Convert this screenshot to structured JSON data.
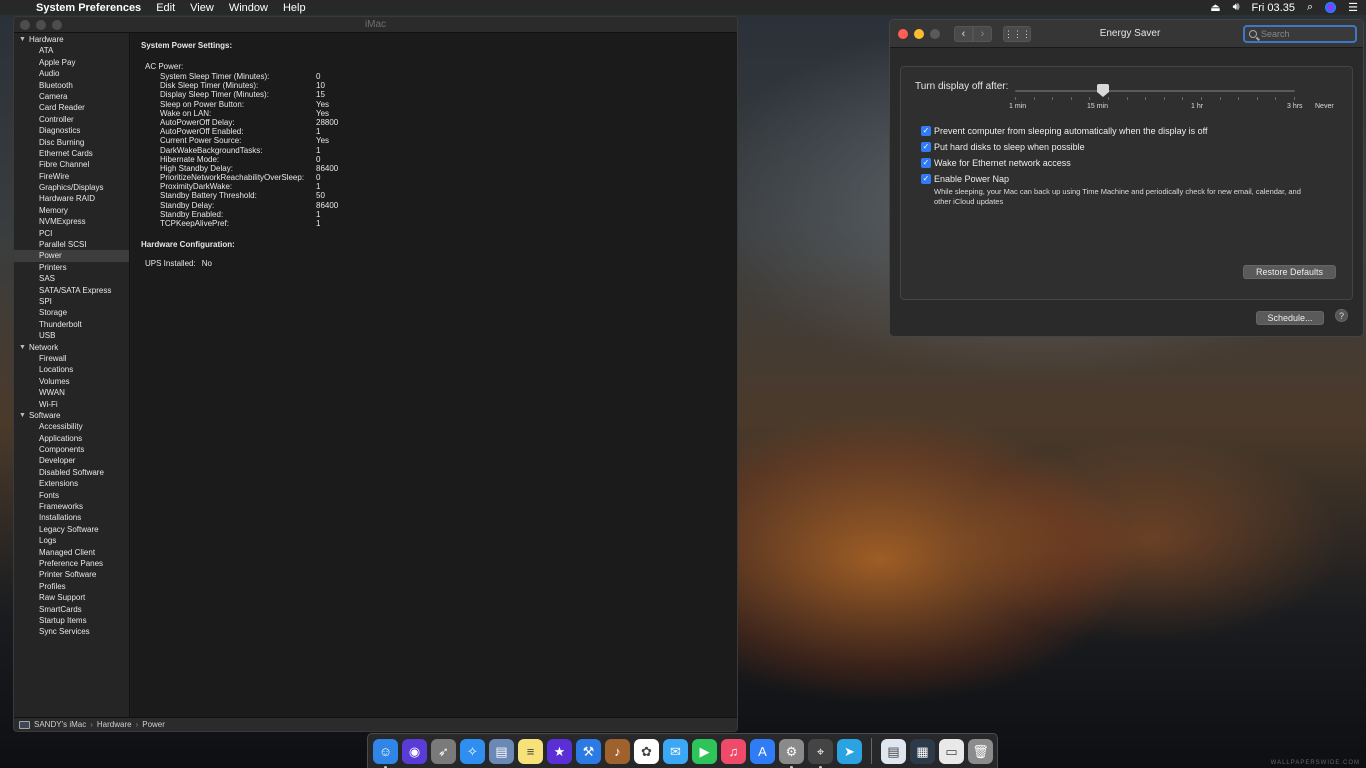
{
  "menubar": {
    "app_name": "System Preferences",
    "items": [
      "Edit",
      "View",
      "Window",
      "Help"
    ],
    "clock": "Fri 03.35"
  },
  "sysinfo": {
    "window_title": "iMac",
    "sidebar": [
      {
        "group": "Hardware",
        "items": [
          "ATA",
          "Apple Pay",
          "Audio",
          "Bluetooth",
          "Camera",
          "Card Reader",
          "Controller",
          "Diagnostics",
          "Disc Burning",
          "Ethernet Cards",
          "Fibre Channel",
          "FireWire",
          "Graphics/Displays",
          "Hardware RAID",
          "Memory",
          "NVMExpress",
          "PCI",
          "Parallel SCSI",
          "Power",
          "Printers",
          "SAS",
          "SATA/SATA Express",
          "SPI",
          "Storage",
          "Thunderbolt",
          "USB"
        ]
      },
      {
        "group": "Network",
        "items": [
          "Firewall",
          "Locations",
          "Volumes",
          "WWAN",
          "Wi-Fi"
        ]
      },
      {
        "group": "Software",
        "items": [
          "Accessibility",
          "Applications",
          "Components",
          "Developer",
          "Disabled Software",
          "Extensions",
          "Fonts",
          "Frameworks",
          "Installations",
          "Legacy Software",
          "Logs",
          "Managed Client",
          "Preference Panes",
          "Printer Software",
          "Profiles",
          "Raw Support",
          "SmartCards",
          "Startup Items",
          "Sync Services"
        ]
      }
    ],
    "selected_item": "Power",
    "content": {
      "section_title": "System Power Settings:",
      "group_title": "AC Power:",
      "settings": [
        {
          "k": "System Sleep Timer (Minutes):",
          "v": "0"
        },
        {
          "k": "Disk Sleep Timer (Minutes):",
          "v": "10"
        },
        {
          "k": "Display Sleep Timer (Minutes):",
          "v": "15"
        },
        {
          "k": "Sleep on Power Button:",
          "v": "Yes"
        },
        {
          "k": "Wake on LAN:",
          "v": "Yes"
        },
        {
          "k": "AutoPowerOff Delay:",
          "v": "28800"
        },
        {
          "k": "AutoPowerOff Enabled:",
          "v": "1"
        },
        {
          "k": "Current Power Source:",
          "v": "Yes"
        },
        {
          "k": "DarkWakeBackgroundTasks:",
          "v": "1"
        },
        {
          "k": "Hibernate Mode:",
          "v": "0"
        },
        {
          "k": "High Standby Delay:",
          "v": "86400"
        },
        {
          "k": "PrioritizeNetworkReachabilityOverSleep:",
          "v": "0"
        },
        {
          "k": "ProximityDarkWake:",
          "v": "1"
        },
        {
          "k": "Standby Battery Threshold:",
          "v": "50"
        },
        {
          "k": "Standby Delay:",
          "v": "86400"
        },
        {
          "k": "Standby Enabled:",
          "v": "1"
        },
        {
          "k": "TCPKeepAlivePref:",
          "v": "1"
        }
      ],
      "hw_title": "Hardware Configuration:",
      "ups_label": "UPS Installed:",
      "ups_value": "No"
    },
    "pathbar": [
      "SANDY's iMac",
      "Hardware",
      "Power"
    ]
  },
  "energy": {
    "window_title": "Energy Saver",
    "search_placeholder": "Search",
    "slider_label": "Turn display off after:",
    "slider_value": "15 min",
    "tick_labels": [
      "1 min",
      "15 min",
      "1 hr",
      "3 hrs",
      "Never"
    ],
    "checkboxes": [
      {
        "label": "Prevent computer from sleeping automatically when the display is off",
        "checked": true
      },
      {
        "label": "Put hard disks to sleep when possible",
        "checked": true
      },
      {
        "label": "Wake for Ethernet network access",
        "checked": true
      },
      {
        "label": "Enable Power Nap",
        "checked": true
      }
    ],
    "power_nap_desc": "While sleeping, your Mac can back up using Time Machine and periodically check for new email, calendar, and other iCloud updates",
    "restore_label": "Restore Defaults",
    "schedule_label": "Schedule...",
    "help_label": "?"
  },
  "dock": {
    "apps": [
      {
        "name": "finder-icon",
        "color": "#2f86e8",
        "glyph": "☺",
        "running": true
      },
      {
        "name": "siri-icon",
        "color": "#5b3bd6",
        "glyph": "◉",
        "running": false
      },
      {
        "name": "launchpad-icon",
        "color": "#7a7a7a",
        "glyph": "➶",
        "running": false
      },
      {
        "name": "safari-icon",
        "color": "#2f8ff0",
        "glyph": "✧",
        "running": false
      },
      {
        "name": "preview-icon",
        "color": "#6b89b4",
        "glyph": "▤",
        "running": false
      },
      {
        "name": "notes-icon",
        "color": "#f7e27a",
        "glyph": "≡",
        "running": false
      },
      {
        "name": "imovie-icon",
        "color": "#5a2fd6",
        "glyph": "★",
        "running": false
      },
      {
        "name": "xcode-icon",
        "color": "#2c7be5",
        "glyph": "⚒",
        "running": false
      },
      {
        "name": "guitar-icon",
        "color": "#a0622d",
        "glyph": "♪",
        "running": false
      },
      {
        "name": "photos-icon",
        "color": "#ffffff",
        "glyph": "✿",
        "running": false
      },
      {
        "name": "messages-icon",
        "color": "#3ba7f5",
        "glyph": "✉",
        "running": false
      },
      {
        "name": "facetime-icon",
        "color": "#2ec45a",
        "glyph": "▶",
        "running": false
      },
      {
        "name": "music-icon",
        "color": "#f04a6a",
        "glyph": "♫",
        "running": false
      },
      {
        "name": "app-store-icon",
        "color": "#2f7cf6",
        "glyph": "A",
        "running": false
      },
      {
        "name": "system-preferences-icon",
        "color": "#8a8a8a",
        "glyph": "⚙",
        "running": true
      },
      {
        "name": "network-utility-icon",
        "color": "#444444",
        "glyph": "⌖",
        "running": true
      },
      {
        "name": "telegram-icon",
        "color": "#2aa3e0",
        "glyph": "➤",
        "running": false
      }
    ],
    "others": [
      {
        "name": "document-icon",
        "color": "#dfe6ef",
        "glyph": "▤"
      },
      {
        "name": "screenshot-folder-icon",
        "color": "#2c3a4a",
        "glyph": "▦"
      },
      {
        "name": "screenshots-stack-icon",
        "color": "#e9e9e9",
        "glyph": "▭"
      },
      {
        "name": "trash-icon",
        "color": "#8c8c8c",
        "glyph": "🗑"
      }
    ],
    "watermark": "WALLPAPERSWIDE.COM"
  }
}
